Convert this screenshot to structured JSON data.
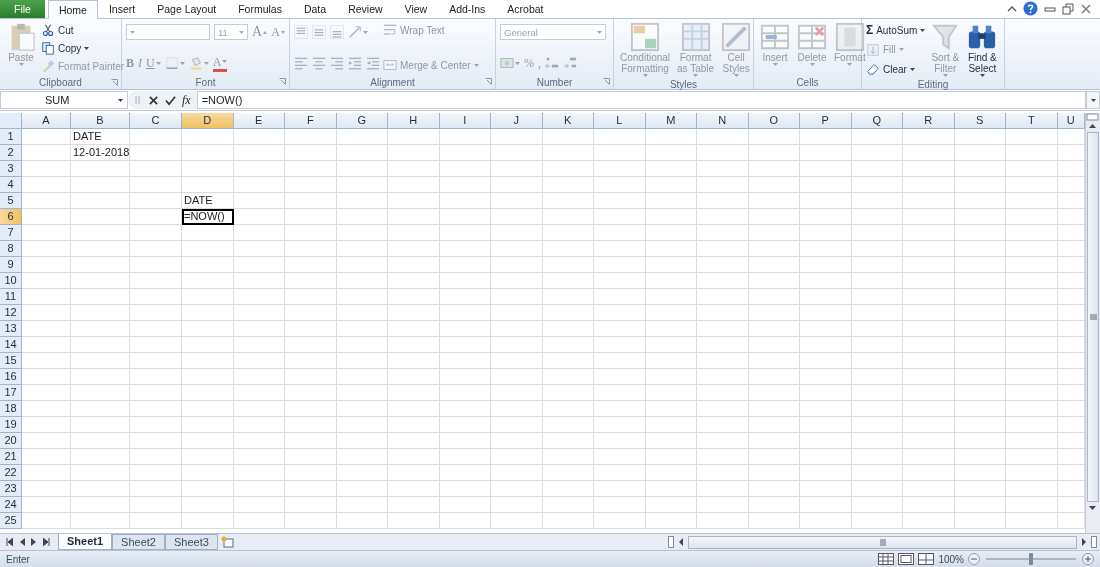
{
  "menu_tabs": [
    {
      "label": "File",
      "kind": "file",
      "selected": false
    },
    {
      "label": "Home",
      "kind": "tab",
      "selected": true
    },
    {
      "label": "Insert",
      "kind": "tab",
      "selected": false
    },
    {
      "label": "Page Layout",
      "kind": "tab",
      "selected": false
    },
    {
      "label": "Formulas",
      "kind": "tab",
      "selected": false
    },
    {
      "label": "Data",
      "kind": "tab",
      "selected": false
    },
    {
      "label": "Review",
      "kind": "tab",
      "selected": false
    },
    {
      "label": "View",
      "kind": "tab",
      "selected": false
    },
    {
      "label": "Add-Ins",
      "kind": "tab",
      "selected": false
    },
    {
      "label": "Acrobat",
      "kind": "tab",
      "selected": false
    }
  ],
  "ribbon": [
    {
      "title": "Clipboard",
      "kind": "clipboard",
      "columns": [
        {
          "lines": [
            {
              "kind": "paste",
              "label_lines": [
                "Paste"
              ],
              "disabled": true
            }
          ]
        },
        {
          "lines": [
            {
              "kind": "cut",
              "label": "Cut",
              "disabled": false
            },
            {
              "kind": "copy",
              "label": "Copy",
              "disabled": false
            },
            {
              "kind": "format-painter",
              "label": "Format Painter",
              "disabled": true
            }
          ]
        }
      ]
    },
    {
      "title": "Font",
      "kind": "font",
      "columns": [
        {
          "lines": [
            {
              "kind": "tools",
              "tools": [
                {
                  "kind": "font-field",
                  "disabled": true
                },
                {
                  "kind": "size-field",
                  "value": "11",
                  "disabled": true
                },
                {
                  "kind": "grow-font",
                  "label": "A",
                  "disabled": true
                },
                {
                  "kind": "shrink-font",
                  "label": "A",
                  "disabled": true
                }
              ]
            },
            {
              "kind": "tools",
              "tools": [
                {
                  "kind": "bold",
                  "label": "B",
                  "disabled": true
                },
                {
                  "kind": "italic",
                  "label": "I",
                  "disabled": true
                },
                {
                  "kind": "underline",
                  "label": "U",
                  "disabled": true
                },
                {
                  "kind": "borders",
                  "disabled": true
                },
                {
                  "kind": "fill-color",
                  "disabled": true
                },
                {
                  "kind": "font-color",
                  "label": "A",
                  "disabled": true
                }
              ]
            }
          ]
        }
      ]
    },
    {
      "title": "Alignment",
      "kind": "alignment",
      "columns": [
        {
          "lines": [
            {
              "kind": "tools",
              "tools": [
                {
                  "kind": "align-top",
                  "disabled": true
                },
                {
                  "kind": "align-middle",
                  "disabled": true
                },
                {
                  "kind": "align-bottom",
                  "disabled": true
                },
                {
                  "kind": "orientation",
                  "disabled": true
                }
              ]
            },
            {
              "kind": "tools",
              "tools": [
                {
                  "kind": "align-left",
                  "disabled": true
                },
                {
                  "kind": "align-center",
                  "disabled": true
                },
                {
                  "kind": "align-right",
                  "disabled": true
                },
                {
                  "kind": "decrease-indent",
                  "disabled": true
                },
                {
                  "kind": "increase-indent",
                  "disabled": true
                }
              ]
            }
          ]
        },
        {
          "lines": [
            {
              "kind": "wrap-text",
              "label": "Wrap Text",
              "disabled": true
            },
            {
              "kind": "merge-center",
              "label": "Merge & Center",
              "disabled": true
            }
          ]
        }
      ]
    },
    {
      "title": "Number",
      "kind": "number",
      "columns": [
        {
          "lines": [
            {
              "kind": "tools",
              "tools": [
                {
                  "kind": "format-field",
                  "value": "General",
                  "disabled": true
                }
              ]
            },
            {
              "kind": "tools",
              "tools": [
                {
                  "kind": "accounting",
                  "disabled": true
                },
                {
                  "kind": "percent",
                  "label": "%",
                  "disabled": true
                },
                {
                  "kind": "comma",
                  "label": ",",
                  "disabled": true
                },
                {
                  "kind": "increase-decimal",
                  "disabled": true
                },
                {
                  "kind": "decrease-decimal",
                  "disabled": true
                }
              ]
            }
          ]
        }
      ]
    },
    {
      "title": "Styles",
      "kind": "styles",
      "columns": [
        {
          "lines": [
            {
              "kind": "conditional-formatting",
              "label_lines": [
                "Conditional",
                "Formatting"
              ],
              "disabled": true
            }
          ]
        },
        {
          "lines": [
            {
              "kind": "format-as-table",
              "label_lines": [
                "Format",
                "as Table"
              ],
              "disabled": true
            }
          ]
        },
        {
          "lines": [
            {
              "kind": "cell-styles",
              "label_lines": [
                "Cell",
                "Styles"
              ],
              "disabled": true
            }
          ]
        }
      ]
    },
    {
      "title": "Cells",
      "kind": "cells",
      "columns": [
        {
          "lines": [
            {
              "kind": "insert",
              "label_lines": [
                "Insert"
              ],
              "disabled": true
            }
          ]
        },
        {
          "lines": [
            {
              "kind": "delete",
              "label_lines": [
                "Delete"
              ],
              "disabled": true
            }
          ]
        },
        {
          "lines": [
            {
              "kind": "format",
              "label_lines": [
                "Format"
              ],
              "disabled": true
            }
          ]
        }
      ]
    },
    {
      "title": "Editing",
      "kind": "editing",
      "columns": [
        {
          "lines": [
            {
              "kind": "autosum",
              "symbol": "Σ",
              "label": "AutoSum",
              "disabled": false
            },
            {
              "kind": "fill",
              "label": "Fill",
              "disabled": true
            },
            {
              "kind": "clear",
              "label": "Clear",
              "disabled": false
            }
          ]
        },
        {
          "lines": [
            {
              "kind": "sort-filter",
              "label_lines": [
                "Sort &",
                "Filter"
              ],
              "disabled": true
            }
          ]
        },
        {
          "lines": [
            {
              "kind": "find-select",
              "label_lines": [
                "Find &",
                "Select"
              ],
              "disabled": false
            }
          ]
        }
      ]
    }
  ],
  "formula_bar": {
    "name_box": "SUM",
    "function_label": "fx",
    "formula": "=NOW()"
  },
  "columns": [
    {
      "label": "A",
      "selected": false
    },
    {
      "label": "B",
      "selected": false
    },
    {
      "label": "C",
      "selected": false
    },
    {
      "label": "D",
      "selected": true
    },
    {
      "label": "E",
      "selected": false
    },
    {
      "label": "F",
      "selected": false
    },
    {
      "label": "G",
      "selected": false
    },
    {
      "label": "H",
      "selected": false
    },
    {
      "label": "I",
      "selected": false
    },
    {
      "label": "J",
      "selected": false
    },
    {
      "label": "K",
      "selected": false
    },
    {
      "label": "L",
      "selected": false
    },
    {
      "label": "M",
      "selected": false
    },
    {
      "label": "N",
      "selected": false
    },
    {
      "label": "O",
      "selected": false
    },
    {
      "label": "P",
      "selected": false
    },
    {
      "label": "Q",
      "selected": false
    },
    {
      "label": "R",
      "selected": false
    },
    {
      "label": "S",
      "selected": false
    },
    {
      "label": "T",
      "selected": false
    },
    {
      "label": "U",
      "selected": false
    }
  ],
  "rows": [
    {
      "number": "1",
      "selected": false,
      "cells": [
        null,
        {
          "value": "DATE",
          "selected": false
        }
      ]
    },
    {
      "number": "2",
      "selected": false,
      "cells": [
        null,
        {
          "value": "12-01-2018",
          "selected": false
        }
      ]
    },
    {
      "number": "3",
      "selected": false
    },
    {
      "number": "4",
      "selected": false
    },
    {
      "number": "5",
      "selected": false,
      "cells": [
        null,
        null,
        null,
        {
          "value": "DATE",
          "selected": false
        }
      ]
    },
    {
      "number": "6",
      "selected": true,
      "cells": [
        null,
        null,
        null,
        {
          "value": "=NOW()",
          "selected": true
        }
      ]
    },
    {
      "number": "7",
      "selected": false
    },
    {
      "number": "8",
      "selected": false
    },
    {
      "number": "9",
      "selected": false
    },
    {
      "number": "10",
      "selected": false
    },
    {
      "number": "11",
      "selected": false
    },
    {
      "number": "12",
      "selected": false
    },
    {
      "number": "13",
      "selected": false
    },
    {
      "number": "14",
      "selected": false
    },
    {
      "number": "15",
      "selected": false
    },
    {
      "number": "16",
      "selected": false
    },
    {
      "number": "17",
      "selected": false
    },
    {
      "number": "18",
      "selected": false
    },
    {
      "number": "19",
      "selected": false
    },
    {
      "number": "20",
      "selected": false
    },
    {
      "number": "21",
      "selected": false
    },
    {
      "number": "22",
      "selected": false
    },
    {
      "number": "23",
      "selected": false
    },
    {
      "number": "24",
      "selected": false
    },
    {
      "number": "25",
      "selected": false
    }
  ],
  "sheet_tabs": [
    {
      "label": "Sheet1",
      "selected": true
    },
    {
      "label": "Sheet2",
      "selected": false
    },
    {
      "label": "Sheet3",
      "selected": false
    }
  ],
  "status_bar": {
    "mode": "Enter",
    "zoom": {
      "reading": "100%",
      "level": 0.5
    }
  }
}
